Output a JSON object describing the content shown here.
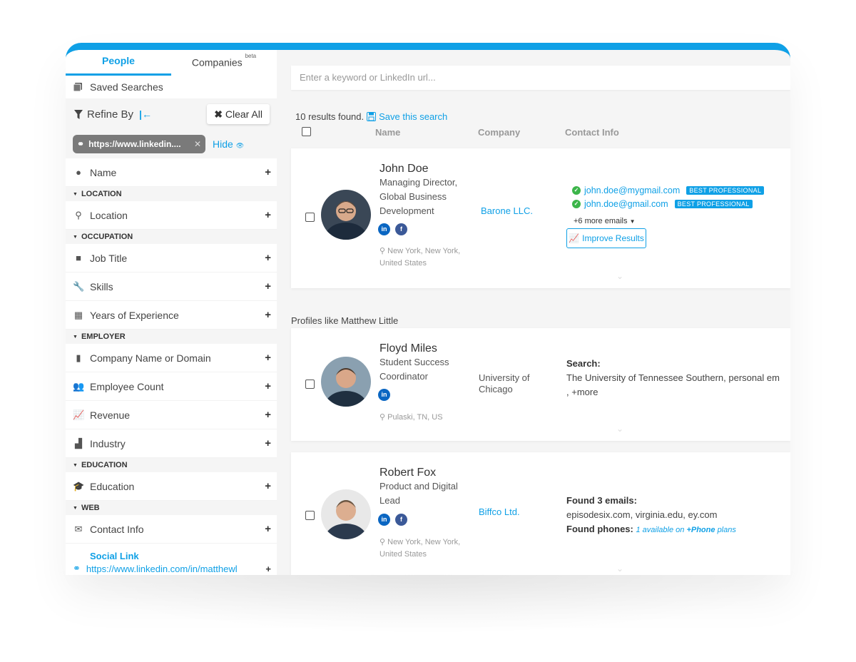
{
  "tabs": {
    "people": "People",
    "companies": "Companies",
    "companies_badge": "beta"
  },
  "saved_searches": "Saved Searches",
  "refine": {
    "title": "Refine By",
    "clear_all": "Clear All"
  },
  "chip": {
    "text": "https://www.linkedin....",
    "hide": "Hide"
  },
  "filters": {
    "name": "Name",
    "location_section": "LOCATION",
    "location": "Location",
    "occupation_section": "OCCUPATION",
    "job_title": "Job Title",
    "skills": "Skills",
    "years": "Years of Experience",
    "employer_section": "EMPLOYER",
    "company_name": "Company Name or Domain",
    "employee_count": "Employee Count",
    "revenue": "Revenue",
    "industry": "Industry",
    "education_section": "EDUCATION",
    "education": "Education",
    "web_section": "WEB",
    "contact_info": "Contact Info",
    "social_link_label": "Social Link",
    "social_link_value": "https://www.linkedin.com/in/matthewl"
  },
  "search": {
    "placeholder": "Enter a keyword or LinkedIn url..."
  },
  "results": {
    "count": "10 results found.",
    "save": "Save this search"
  },
  "columns": {
    "name": "Name",
    "company": "Company",
    "contact": "Contact Info"
  },
  "profiles_like": "Profiles like Matthew Little",
  "cards": [
    {
      "name": "John Doe",
      "title": "Managing Director, Global Business Development",
      "company": "Barone LLC.",
      "location": "New York, New York, United States",
      "emails": [
        {
          "email": "john.doe@mygmail.com",
          "badge": "BEST PROFESSIONAL"
        },
        {
          "email": "john.doe@gmail.com",
          "badge": "BEST PROFESSIONAL"
        }
      ],
      "more_emails": "+6 more emails",
      "improve": "Improve Results"
    },
    {
      "name": "Floyd Miles",
      "title": "Student Success Coordinator",
      "company": "University of Chicago",
      "location": "Pulaski, TN, US",
      "search_label": "Search:",
      "search_text": "The University of Tennessee Southern, personal em",
      "more": ",  +more"
    },
    {
      "name": "Robert Fox",
      "title": "Product and Digital Lead",
      "company": "Biffco Ltd.",
      "location": "New York, New York, United States",
      "found_emails_label": "Found 3 emails:",
      "found_emails": "episodesix.com, virginia.edu, ey.com",
      "found_phones_label": "Found phones:",
      "phones_text": "1 available on",
      "phones_plan": "+Phone",
      "phones_suffix": "plans"
    }
  ],
  "colors": {
    "accent": "#0fa0e6",
    "check": "#3cb54a",
    "linkedin": "#0a66c2",
    "facebook": "#3b5998"
  }
}
